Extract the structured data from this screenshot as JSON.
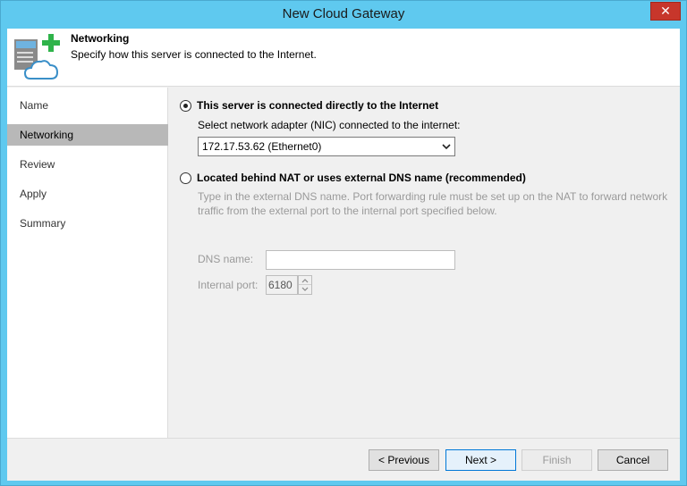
{
  "window": {
    "title": "New Cloud Gateway",
    "close_glyph": "✕"
  },
  "header": {
    "title": "Networking",
    "subtitle": "Specify how this server is connected to the Internet.",
    "icon": "server-cloud-add-icon"
  },
  "sidebar": {
    "items": [
      {
        "label": "Name",
        "active": false
      },
      {
        "label": "Networking",
        "active": true
      },
      {
        "label": "Review",
        "active": false
      },
      {
        "label": "Apply",
        "active": false
      },
      {
        "label": "Summary",
        "active": false
      }
    ]
  },
  "main": {
    "option_direct": {
      "label": "This server is connected directly to the Internet",
      "checked": true
    },
    "nic_label": "Select network adapter (NIC) connected to the internet:",
    "nic_value": "172.17.53.62 (Ethernet0)",
    "option_nat": {
      "label": "Located behind NAT or uses external DNS name (recommended)",
      "checked": false
    },
    "nat_desc_line1": "Type in the external DNS name. Port forwarding rule must be set up on the NAT to forward network",
    "nat_desc_line2": "traffic from the external port to the internal port specified below.",
    "dns_label": "DNS name:",
    "dns_value": "",
    "port_label": "Internal port:",
    "port_value": "6180"
  },
  "footer": {
    "previous": "< Previous",
    "next": "Next >",
    "finish": "Finish",
    "cancel": "Cancel"
  },
  "colors": {
    "frame": "#5fc9ef",
    "close": "#c7362b",
    "selection": "#b8b8b8"
  }
}
